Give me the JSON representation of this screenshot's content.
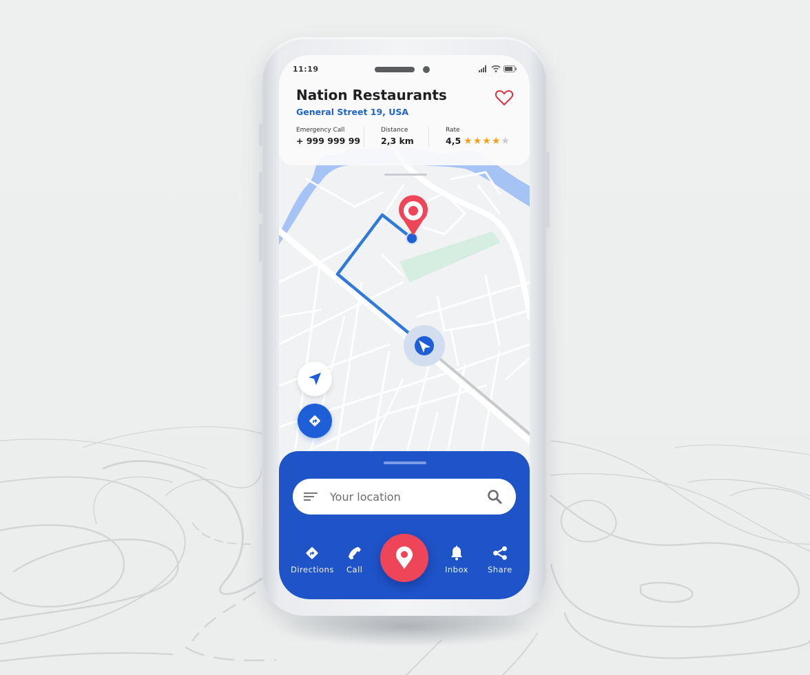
{
  "status_bar": {
    "time": "11:19",
    "icons": [
      "signal-icon",
      "wifi-icon",
      "battery-icon"
    ]
  },
  "place": {
    "name": "Nation Restaurants",
    "address": "General Street 19, USA",
    "favorite_icon": "heart-outline-icon",
    "stats": [
      {
        "label": "Emergency Call",
        "value": "+ 999 999 99"
      },
      {
        "label": "Distance",
        "value": "2,3 km"
      },
      {
        "label": "Rate",
        "value": "4,5"
      }
    ],
    "rating": {
      "filled_stars": 4,
      "total_stars": 5
    }
  },
  "map": {
    "destination_pin_icon": "map-pin-icon",
    "current_position_icon": "navigation-arrow-icon",
    "colors": {
      "route": "#2f7ad8",
      "water": "#a5c4f5",
      "park": "#d6ede1",
      "road": "#ffffff",
      "pin": "#ef4558"
    }
  },
  "map_controls": {
    "locate_icon": "navigation-arrow-icon",
    "directions_icon": "directions-diamond-icon"
  },
  "search": {
    "placeholder": "Your location",
    "value": "",
    "menu_icon": "filter-lines-icon",
    "search_icon": "search-icon"
  },
  "bottom_nav": {
    "items": [
      {
        "label": "Directions",
        "icon": "directions-diamond-icon"
      },
      {
        "label": "Call",
        "icon": "phone-icon"
      },
      {
        "label": "Inbox",
        "icon": "bell-icon"
      },
      {
        "label": "Share",
        "icon": "share-icon"
      }
    ],
    "center_icon": "map-pin-icon"
  },
  "theme": {
    "primary": "#1f53c8",
    "accent": "#ef4558",
    "star": "#f4a01c",
    "link": "#1f64c8"
  }
}
